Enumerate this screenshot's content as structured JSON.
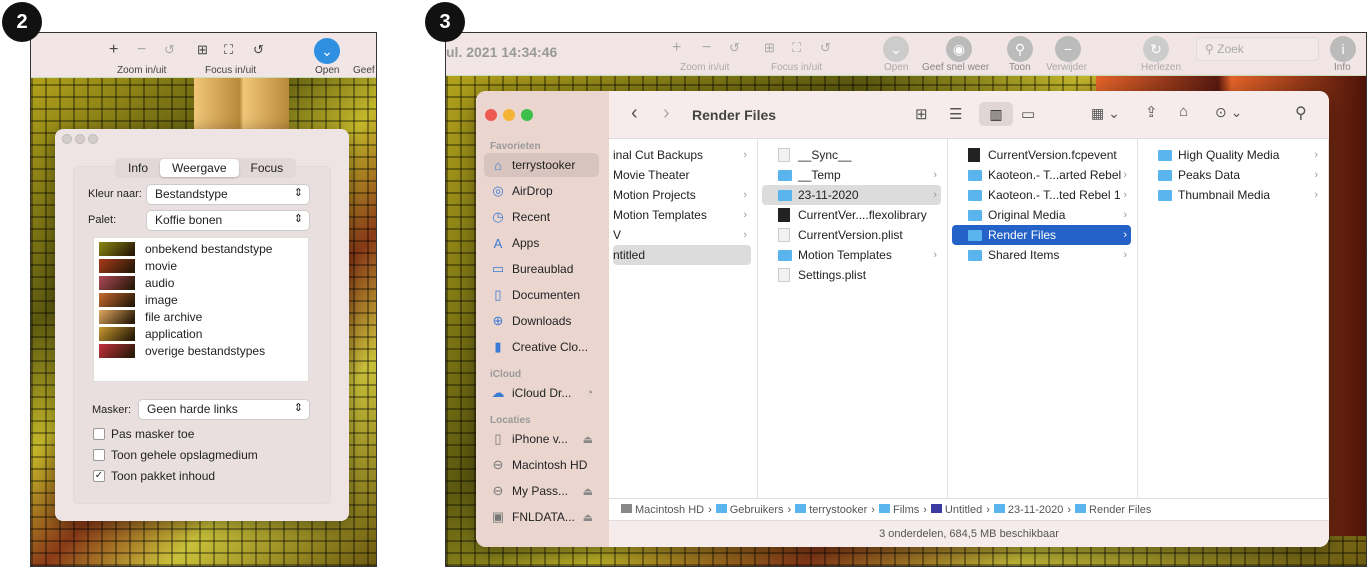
{
  "badges": [
    "2",
    "3"
  ],
  "left": {
    "toolbar": {
      "zoom_label": "Zoom in/uit",
      "focus_label": "Focus in/uit",
      "open_label": "Open",
      "geef_label": "Geef"
    },
    "dialog": {
      "tabs": [
        {
          "label": "Info"
        },
        {
          "label": "Weergave",
          "active": true
        },
        {
          "label": "Focus"
        }
      ],
      "kleur_label": "Kleur naar:",
      "kleur_value": "Bestandstype",
      "palet_label": "Palet:",
      "palet_value": "Koffie bonen",
      "legend": [
        {
          "label": "onbekend bestandstype",
          "color": "#8a8a10"
        },
        {
          "label": "movie",
          "color": "#a83a1a"
        },
        {
          "label": "audio",
          "color": "#b0485a"
        },
        {
          "label": "image",
          "color": "#c86a30"
        },
        {
          "label": "file archive",
          "color": "#e0a860"
        },
        {
          "label": "application",
          "color": "#c89a30"
        },
        {
          "label": "overige bestandstypes",
          "color": "#c83040"
        }
      ],
      "masker_label": "Masker:",
      "masker_value": "Geen harde links",
      "checkboxes": [
        {
          "label": "Pas masker toe",
          "checked": false
        },
        {
          "label": "Toon gehele opslagmedium",
          "checked": false
        },
        {
          "label": "Toon pakket inhoud",
          "checked": true
        }
      ]
    }
  },
  "right": {
    "toolbar": {
      "date": "ul. 2021 14:34:46",
      "zoom_label": "Zoom in/uit",
      "focus_label": "Focus in/uit",
      "open": "Open",
      "quicklook": "Geef snel weer",
      "toon": "Toon",
      "verwijder": "Verwijder",
      "herlezen": "Herlezen",
      "search_placeholder": "Zoek",
      "info": "Info"
    },
    "finder": {
      "title": "Render Files",
      "sidebar": {
        "favorites_header": "Favorieten",
        "favorites": [
          {
            "label": "terrystooker",
            "icon": "home-icon"
          },
          {
            "label": "AirDrop",
            "icon": "airdrop-icon"
          },
          {
            "label": "Recent",
            "icon": "clock-icon"
          },
          {
            "label": "Apps",
            "icon": "apps-icon"
          },
          {
            "label": "Bureaublad",
            "icon": "desktop-icon"
          },
          {
            "label": "Documenten",
            "icon": "document-icon"
          },
          {
            "label": "Downloads",
            "icon": "download-icon"
          },
          {
            "label": "Creative Clo...",
            "icon": "file-icon"
          }
        ],
        "icloud_header": "iCloud",
        "icloud": [
          {
            "label": "iCloud Dr...",
            "icon": "cloud-icon"
          }
        ],
        "locations_header": "Locaties",
        "locations": [
          {
            "label": "iPhone v...",
            "icon": "phone-icon"
          },
          {
            "label": "Macintosh HD",
            "icon": "disk-icon"
          },
          {
            "label": "My Pass...",
            "icon": "disk-icon"
          },
          {
            "label": "FNLDATA...",
            "icon": "server-icon"
          }
        ]
      },
      "columns": [
        [
          {
            "name": "inal Cut Backups",
            "type": "none",
            "arrow": true
          },
          {
            "name": "Movie Theater",
            "type": "none"
          },
          {
            "name": "Motion Projects",
            "type": "none",
            "arrow": true
          },
          {
            "name": "Motion Templates",
            "type": "none",
            "arrow": true
          },
          {
            "name": "V",
            "type": "none",
            "arrow": true
          },
          {
            "name": "ntitled",
            "type": "none",
            "state": "gray"
          }
        ],
        [
          {
            "name": "__Sync__",
            "type": "doc"
          },
          {
            "name": "__Temp",
            "type": "folder",
            "arrow": true
          },
          {
            "name": "23-11-2020",
            "type": "folder",
            "arrow": true,
            "state": "gray"
          },
          {
            "name": "CurrentVer....flexolibrary",
            "type": "blk"
          },
          {
            "name": "CurrentVersion.plist",
            "type": "doc"
          },
          {
            "name": "Motion Templates",
            "type": "folder",
            "arrow": true
          },
          {
            "name": "Settings.plist",
            "type": "doc"
          }
        ],
        [
          {
            "name": "CurrentVersion.fcpevent",
            "type": "blk"
          },
          {
            "name": "Kaoteon.- T...arted Rebel",
            "type": "folder",
            "arrow": true
          },
          {
            "name": "Kaoteon.- T...ted Rebel 1",
            "type": "folder",
            "arrow": true
          },
          {
            "name": "Original Media",
            "type": "folder",
            "arrow": true
          },
          {
            "name": "Render Files",
            "type": "folder",
            "arrow": true,
            "state": "blue"
          },
          {
            "name": "Shared Items",
            "type": "folder",
            "arrow": true
          }
        ],
        [
          {
            "name": "High Quality Media",
            "type": "folder",
            "arrow": true
          },
          {
            "name": "Peaks Data",
            "type": "folder",
            "arrow": true
          },
          {
            "name": "Thumbnail Media",
            "type": "folder",
            "arrow": true
          }
        ]
      ],
      "path": [
        "Macintosh HD",
        "Gebruikers",
        "terrystooker",
        "Films",
        "Untitled",
        "23-11-2020",
        "Render Files"
      ],
      "status": "3 onderdelen, 684,5 MB beschikbaar"
    }
  }
}
